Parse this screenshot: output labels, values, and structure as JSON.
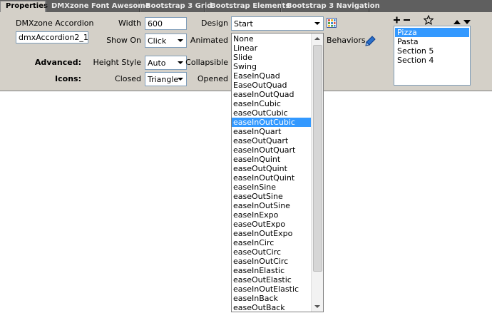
{
  "tabs": [
    {
      "label": "Properties",
      "active": true
    },
    {
      "label": "DMXzone Font Awesome",
      "active": false
    },
    {
      "label": "Bootstrap 3 Grid",
      "active": false
    },
    {
      "label": "Bootstrap Elements",
      "active": false
    },
    {
      "label": "Bootstrap 3 Navigation",
      "active": false
    }
  ],
  "component": {
    "title": "DMXzone Accordion",
    "id_value": "dmxAccordion2_1"
  },
  "fields": {
    "width_label": "Width",
    "width_value": "600",
    "design_label": "Design",
    "design_value": "Start",
    "show_on_label": "Show On",
    "show_on_value": "Click",
    "animated_label": "Animated",
    "advanced_label": "Advanced:",
    "height_style_label": "Height Style",
    "height_style_value": "Auto",
    "collapsible_label": "Collapsible",
    "icons_label": "Icons:",
    "closed_label": "Closed",
    "closed_value": "Triangle",
    "opened_label": "Opened",
    "behaviors_label": "Behaviors"
  },
  "easing_dropdown": {
    "options": [
      "None",
      "Linear",
      "Slide",
      "Swing",
      "EaseInQuad",
      "EaseOutQuad",
      "easeInOutQuad",
      "easeInCubic",
      "easeOutCubic",
      "easeInOutCubic",
      "easeInQuart",
      "easeOutQuart",
      "easeInOutQuart",
      "easeInQuint",
      "easeOutQuint",
      "easeInOutQuint",
      "easeInSine",
      "easeOutSine",
      "easeInOutSine",
      "easeInExpo",
      "easeOutExpo",
      "easeInOutExpo",
      "easeInCirc",
      "easeOutCirc",
      "easeInOutCirc",
      "easeInElastic",
      "easeOutElastic",
      "easeInOutElastic",
      "easeInBack",
      "easeOutBack"
    ],
    "selected": "easeInOutCubic"
  },
  "sections": {
    "items": [
      "Pizza",
      "Pasta",
      "Section 5",
      "Section 4"
    ],
    "selected": "Pizza",
    "toolbar_icons": [
      "plus-icon",
      "minus-icon",
      "star-icon",
      "move-up-icon",
      "move-down-icon"
    ]
  },
  "colors": {
    "selection": "#3399ff",
    "panel_bg": "#d4d0c8",
    "tabbar_bg": "#5f5f5f"
  }
}
